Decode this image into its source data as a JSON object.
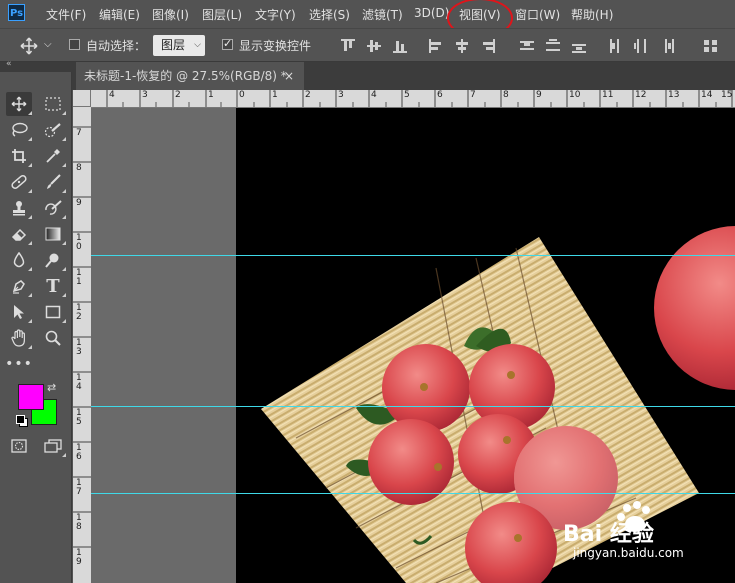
{
  "app": {
    "logo": "Ps"
  },
  "menu": [
    "文件(F)",
    "编辑(E)",
    "图像(I)",
    "图层(L)",
    "文字(Y)",
    "选择(S)",
    "滤镜(T)",
    "3D(D)",
    "视图(V)",
    "窗口(W)",
    "帮助(H)"
  ],
  "options": {
    "auto_select_label": "自动选择：",
    "auto_select_checked": false,
    "layer_select_value": "图层",
    "show_transform_label": "显示变换控件",
    "show_transform_checked": true
  },
  "document_tab": {
    "title": "未标题-1-恢复的 @ 27.5%(RGB/8) *",
    "close": "×"
  },
  "ruler_top": [
    "4",
    "3",
    "2",
    "1",
    "0",
    "1",
    "2",
    "3",
    "4",
    "5",
    "6",
    "7",
    "8",
    "9",
    "10",
    "11",
    "12",
    "13",
    "14",
    "15"
  ],
  "ruler_left": [
    "7",
    "8",
    "9",
    "1 0",
    "1 1",
    "1 2",
    "1 3",
    "1 4",
    "1 5",
    "1 6",
    "1 7",
    "1 8",
    "1 9"
  ],
  "colors": {
    "foreground": "#ff00ff",
    "background": "#00ff00",
    "guide": "#3fd9e8",
    "highlight": "#e0141a"
  },
  "watermark": {
    "brand": "Bai 经验",
    "url": "jingyan.baidu.com"
  }
}
